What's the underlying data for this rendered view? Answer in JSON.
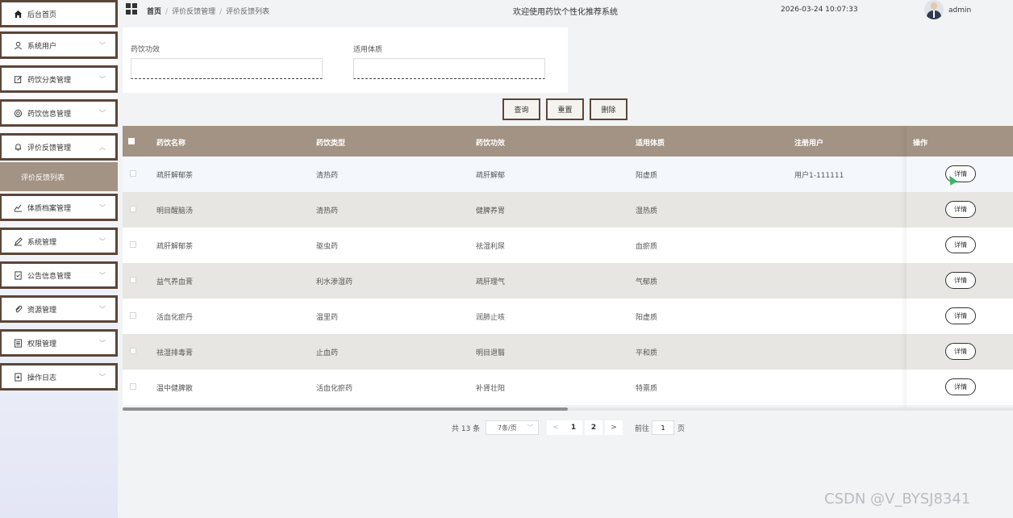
{
  "sidebar": {
    "items": [
      {
        "label": "后台首页",
        "icon": "home-icon"
      },
      {
        "label": "系统用户",
        "icon": "user-icon"
      },
      {
        "label": "药饮分类管理",
        "icon": "edit-icon"
      },
      {
        "label": "药饮信息管理",
        "icon": "target-icon"
      },
      {
        "label": "评价反馈管理",
        "icon": "bell-icon"
      },
      {
        "label": "体质档案管理",
        "icon": "chart-icon"
      },
      {
        "label": "系统管理",
        "icon": "pen-icon"
      },
      {
        "label": "公告信息管理",
        "icon": "doc-check-icon"
      },
      {
        "label": "资源管理",
        "icon": "clip-icon"
      },
      {
        "label": "权限管理",
        "icon": "list-icon"
      },
      {
        "label": "操作日志",
        "icon": "doc-plus-icon"
      }
    ],
    "submenu": {
      "label": "评价反馈列表"
    }
  },
  "header": {
    "breadcrumb": [
      "首页",
      "评价反馈管理",
      "评价反馈列表"
    ],
    "separator": "/",
    "site_title": "欢迎使用药饮个性化推荐系统",
    "datetime": "2026-03-24 10:07:33",
    "username": "admin"
  },
  "search": {
    "field1": {
      "label": "药饮功效",
      "value": ""
    },
    "field2": {
      "label": "适用体质",
      "value": ""
    }
  },
  "actions": {
    "query": "查询",
    "reset": "重置",
    "delete": "删除"
  },
  "table": {
    "headers": [
      "药饮名称",
      "药饮类型",
      "药饮功效",
      "适用体质",
      "注册用户",
      "操作"
    ],
    "detail_label": "详情",
    "rows": [
      [
        "疏肝解郁茶",
        "清热药",
        "疏肝解郁",
        "阳虚质",
        "用户1-111111"
      ],
      [
        "明目醒脑汤",
        "清热药",
        "健脾养胃",
        "湿热质",
        ""
      ],
      [
        "疏肝解郁茶",
        "驱虫药",
        "祛湿利尿",
        "血瘀质",
        ""
      ],
      [
        "益气养血膏",
        "利水渗湿药",
        "疏肝理气",
        "气郁质",
        ""
      ],
      [
        "活血化瘀丹",
        "温里药",
        "润肺止咳",
        "阳虚质",
        ""
      ],
      [
        "祛湿排毒膏",
        "止血药",
        "明目退翳",
        "平和质",
        ""
      ],
      [
        "温中健脾散",
        "活血化瘀药",
        "补肾壮阳",
        "特禀质",
        ""
      ]
    ]
  },
  "pagination": {
    "total": "共 13 条",
    "page_size": "7条/页",
    "pages": [
      "1",
      "2"
    ],
    "goto_label": "前往",
    "goto_value": "1",
    "page_suffix": "页"
  },
  "watermark": "CSDN @V_BYSJ8341",
  "colors": {
    "accent": "#a39384",
    "border": "#5b4639"
  }
}
